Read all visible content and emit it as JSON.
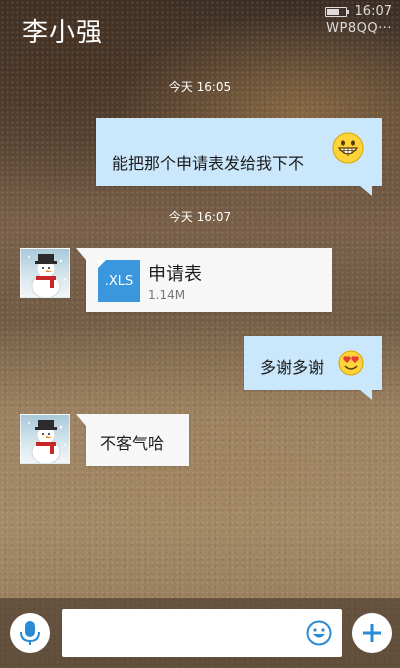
{
  "header": {
    "title": "李小强",
    "status_time": "16:07",
    "status_account": "WP8QQ···"
  },
  "messages": [
    {
      "timestamp": "今天 16:05"
    },
    {
      "direction": "out",
      "text": "能把那个申请表发给我下不",
      "emoji": "grinning-face"
    },
    {
      "timestamp": "今天 16:07"
    },
    {
      "direction": "in",
      "type": "file",
      "file_ext": ".XLS",
      "file_name": "申请表",
      "file_size": "1.14M"
    },
    {
      "direction": "out",
      "text": "多谢多谢",
      "emoji": "heart-eyes-face"
    },
    {
      "direction": "in",
      "text": "不客气哈"
    }
  ],
  "composer": {
    "value": "",
    "placeholder": ""
  },
  "colors": {
    "outgoing_bubble": "#cbe7fb",
    "incoming_bubble": "#f7f7f7",
    "accent": "#2a8ad4"
  }
}
